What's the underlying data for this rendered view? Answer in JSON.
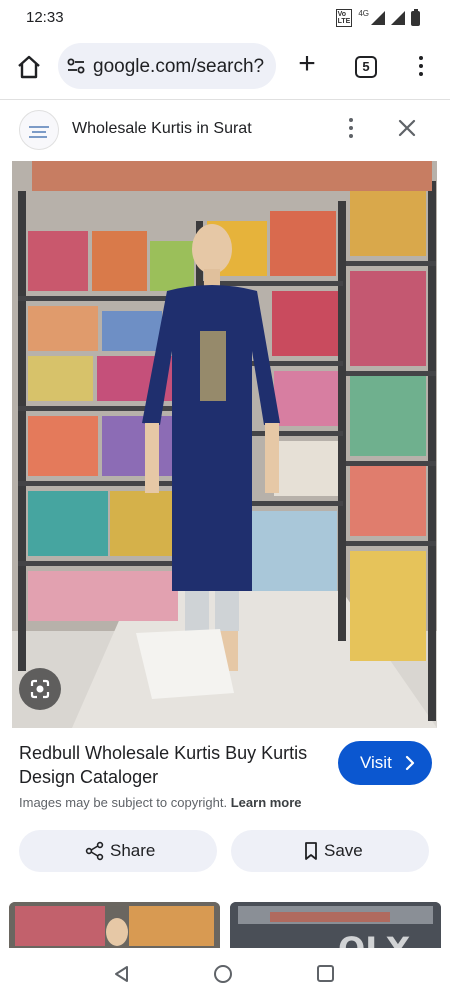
{
  "status_bar": {
    "time": "12:33",
    "volte": "VoLTE",
    "network": "4G"
  },
  "browser": {
    "url": "google.com/search?",
    "tab_count": "5",
    "icons": {
      "home": "home-icon",
      "site_info": "tune-icon",
      "new_tab": "plus-icon",
      "menu": "more-vert-icon"
    }
  },
  "result": {
    "site_title": "Wholesale Kurtis in Surat",
    "image_caption": "Redbull Wholesale Kurtis Buy Kurtis Design Cataloger",
    "visit_label": "Visit",
    "copyright_notice": "Images may be subject to copyright.",
    "learn_more_label": "Learn more",
    "share_label": "Share",
    "save_label": "Save"
  },
  "watermark": {
    "brand": "OLX"
  },
  "colors": {
    "visit_button": "#0b57d0",
    "pill_background": "#eef0f7",
    "kurti_navy": "#1f2f6e"
  }
}
